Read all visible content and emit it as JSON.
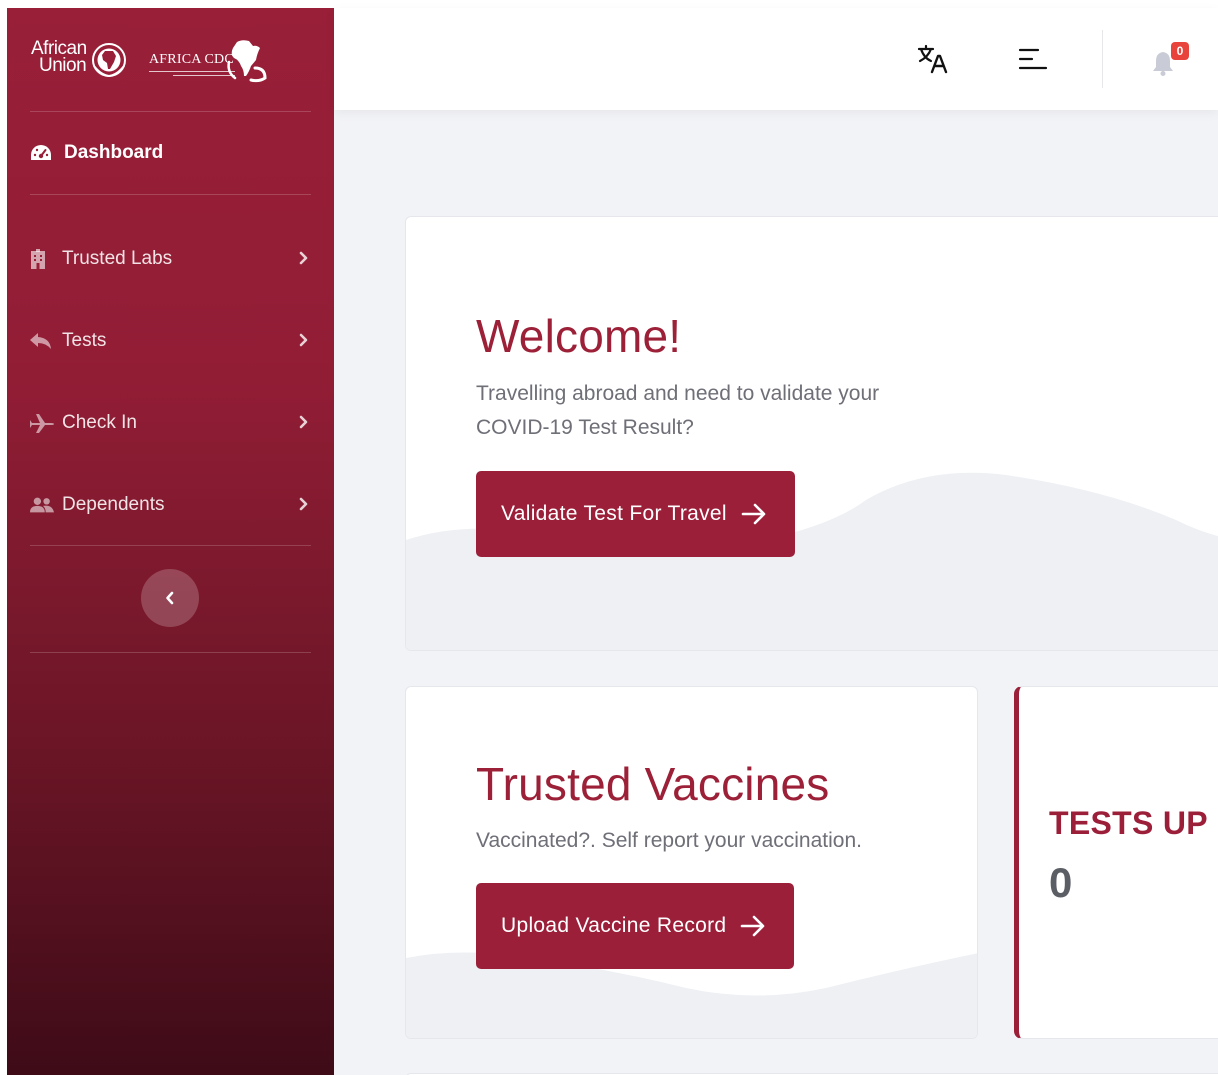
{
  "brand": {
    "au_line1": "African",
    "au_line2": "Union",
    "cdc_name": "AFRICA CDC"
  },
  "sidebar": {
    "dashboard_label": "Dashboard",
    "items": [
      {
        "label": "Trusted Labs",
        "icon": "building-icon"
      },
      {
        "label": "Tests",
        "icon": "reply-icon"
      },
      {
        "label": "Check In",
        "icon": "plane-icon"
      },
      {
        "label": "Dependents",
        "icon": "users-icon"
      }
    ]
  },
  "topbar": {
    "notification_count": "0"
  },
  "welcome": {
    "title": "Welcome!",
    "desc_line1": "Travelling abroad and need to validate your",
    "desc_line2": "COVID-19 Test Result?",
    "button_label": "Validate Test For Travel"
  },
  "vaccines": {
    "title": "Trusted Vaccines",
    "desc": "Vaccinated?. Self report your vaccination.",
    "button_label": "Upload Vaccine Record"
  },
  "tests_card": {
    "title": "TESTS UP",
    "count": "0"
  },
  "colors": {
    "primary": "#9c1f3a",
    "sidebar_top": "#991f38",
    "sidebar_bottom": "#3e0b17",
    "background": "#f2f3f7",
    "badge": "#e8443b"
  }
}
